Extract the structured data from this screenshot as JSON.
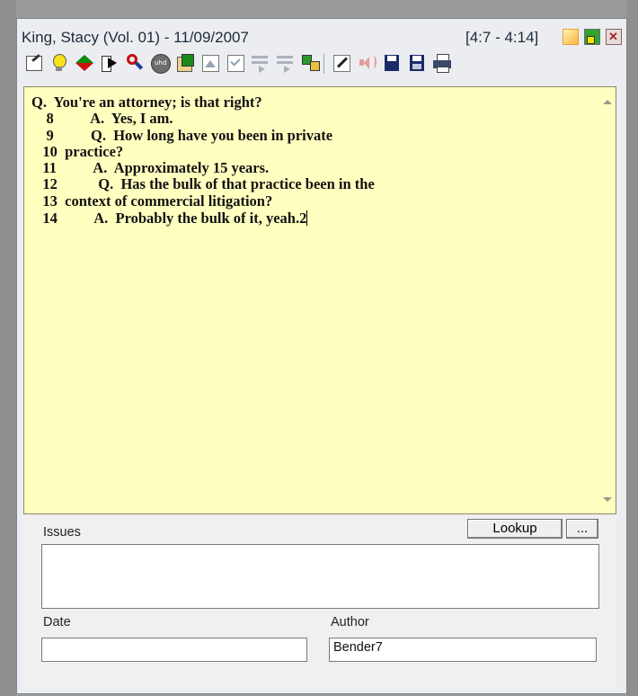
{
  "window": {
    "title": "King, Stacy (Vol. 01) - 11/09/2007",
    "page_range": "[4:7 - 4:14]"
  },
  "toolbar": {
    "icons": [
      "edit-note-icon",
      "lightbulb-icon",
      "arrows-icon",
      "go-to-icon",
      "find-icon",
      "disc-icon",
      "clipboard-icon",
      "image-icon",
      "checkmark-doc-icon",
      "notes-icon",
      "notes-icon-2",
      "sync-icon",
      "pen-icon",
      "speaker-icon",
      "save-icon",
      "save-all-icon",
      "print-icon"
    ]
  },
  "transcript": {
    "lines": [
      "Q.  You're an attorney; is that right?",
      "    8          A.  Yes, I am.",
      "    9          Q.  How long have you been in private",
      "   10  practice?",
      "   11          A.  Approximately 15 years.",
      "   12           Q.  Has the bulk of that practice been in the",
      "   13  context of commercial litigation?",
      "   14          A.  Probably the bulk of it, yeah.2"
    ]
  },
  "issues": {
    "label": "Issues",
    "lookup_label": "Lookup",
    "more_label": "...",
    "value": ""
  },
  "date": {
    "label": "Date",
    "value": ""
  },
  "author": {
    "label": "Author",
    "value": "Bender7"
  }
}
